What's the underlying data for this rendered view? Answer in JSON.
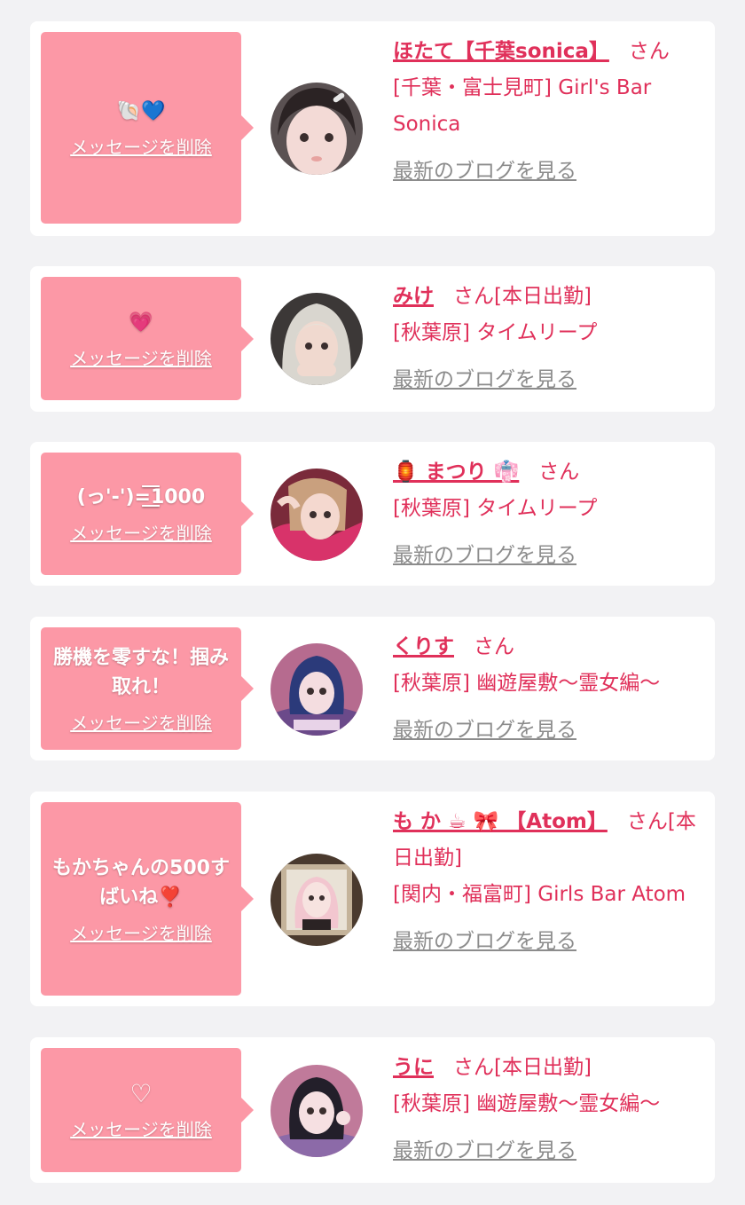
{
  "delete_label": "メッセージを削除",
  "blog_label": "最新のブログを見る",
  "cards": [
    {
      "message": "🐚💙",
      "name": "ほたて【千葉sonica】",
      "san": "さん",
      "status": "",
      "shop": "[千葉・富士見町] Girl's Bar Sonica"
    },
    {
      "message": "💗",
      "name": "みけ",
      "san": "さん",
      "status": "[本日出勤]",
      "shop": "[秋葉原] タイムリープ"
    },
    {
      "message": "(っ'-')=͟͟͞͞1000",
      "name": "🏮 まつり 👘",
      "san": "さん",
      "status": "",
      "shop": "[秋葉原] タイムリープ"
    },
    {
      "message": "勝機を零すな！掴み取れ！",
      "name": "くりす",
      "san": "さん",
      "status": "",
      "shop": "[秋葉原] 幽遊屋敷〜霊女編〜"
    },
    {
      "message": "もかちゃんの500すばいね❣️",
      "name": "も か ☕ 🎀 【Atom】",
      "san": "さん",
      "status": "[本日出勤]",
      "shop": "[関内・福富町] Girls Bar Atom"
    },
    {
      "message": "♡",
      "name": "うに",
      "san": "さん",
      "status": "[本日出勤]",
      "shop": "[秋葉原] 幽遊屋敷〜霊女編〜"
    }
  ]
}
